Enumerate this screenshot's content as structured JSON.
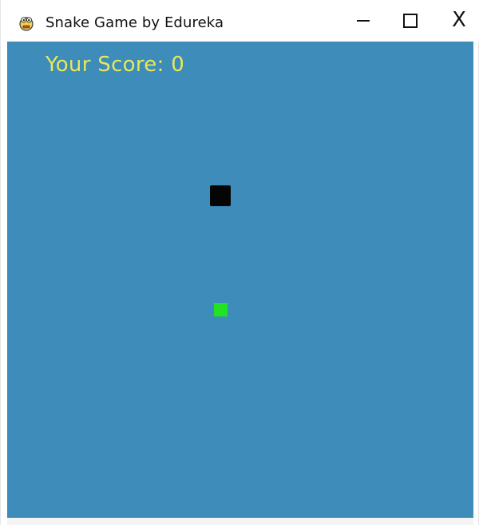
{
  "window": {
    "title": "Snake Game by Edureka",
    "icon": "pygame-snake-icon",
    "controls": {
      "minimize_icon": "minimize-icon",
      "maximize_icon": "maximize-icon",
      "close_label": "X"
    }
  },
  "game": {
    "score_text": "Your Score: 0",
    "background_color": "#3d8cba",
    "score_color": "#e7e85a",
    "snake_color": "#050505",
    "food_color": "#22e322"
  }
}
